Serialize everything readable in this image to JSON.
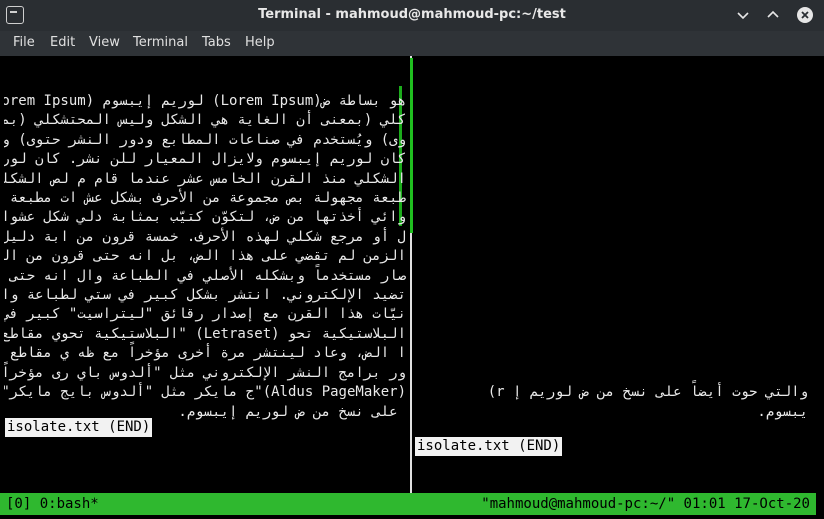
{
  "window": {
    "title": "Terminal - mahmoud@mahmoud-pc:~/test"
  },
  "menu": {
    "items": [
      {
        "label": "File"
      },
      {
        "label": "Edit"
      },
      {
        "label": "View"
      },
      {
        "label": "Terminal"
      },
      {
        "label": "Tabs"
      },
      {
        "label": "Help"
      }
    ]
  },
  "panes": {
    "left": {
      "lines": [
        "هو بساطة ض(Lorem Ipsum) لوريم إيبسوم (Lorem Ipsum)لوريم إيبسوم",
        "كلي (بمعنى أن الغاية هي الشكل وليس المحتشكلي (بمعنى أن الغاية هي الشكل وليس الم",
        "وى) ويُستخدم في صناعات المطابع ودور النشر حتوى) ويُستخدم في صناعات المطابع ودور ال",
        "كان لوريم إيبسوم ولايزال المعيار للن نشر. كان لوريم إيبسوم ولايزال المعيار ل.",
        "الشكلي منذ القرن الخامس عشر عندما قام م لص الشكلي منذ القرن الخامس عشر عندما ق",
        "طبعة مجهولة بص مجموعة من الأحرف بشكل عش ات مطبعة مجهولة بص مجموعة من الأحرف ب",
        "وائي أخذتها من ض، لتكوّن كتيّب بمثابة دلي شكل عشوائي أخذتها من ض، لتكوّن كتيّب بث",
        "ل أو مرجع شكلي لهذه الأحرف. خمسة قرون من ابة دليل أو مرجع شكلي لهذه الأحرف. خمسة",
        "الزمن لم تقضي على هذا الض، بل انه حتى قرون من الزمن لم تقضي على هذا الض، بل",
        "صار مستخدماً وبشكله الأصلي في الطباعة وال انه حتى صار مستخدماً وبشكله الأصلي في ا",
        "تضيد الإلكتروني. انتشر بشكل كبير في ستي لطباعة والتضيد الإلكتروني. انتشر بشكل",
        "نيّات هذا القرن مع إصدار رقائق \"ليتراسيت\" كبير في ستينيّات هذا القرن مع إصدار رقائ",
        "البلاستيكية تحو (Letraset) \"البلاستيكية تحوي مقاطع من هذا ق \"ليتراسيت\" (Letraset)",
        "ا الض، وعاد لينتشر مرة أخرى مؤخراً مع ظه ي مقاطع من هذا الض، وعاد لينتشر مرة أخ",
        "ور برامج النشر الإلكتروني مثل \"ألدوس باي رى مؤخراً مع ظهور برامج النشر الإلكتروني",
        "(Aldus PageMaker)\"ج مايكر مثل \"ألدوس بايج مايكر\" (Aldus PageMaker) \"والتي حوت أيض",
        "ً على نسخ من ض لوريم إيبسوم."
      ],
      "end_marker": "isolate.txt (END)"
    },
    "right": {
      "lines": [
        "",
        "",
        "",
        "",
        "",
        "",
        "",
        "",
        "",
        "",
        "",
        "",
        "",
        "",
        "",
        "والتي حوت أيضاً على نسخ من ض لوريم إ r)",
        "يبسوم."
      ],
      "end_marker": "isolate.txt (END)"
    }
  },
  "status": {
    "left": "[0] 0:bash*",
    "right": "\"mahmoud@mahmoud-pc:~/\" 01:01 17-Oct-20"
  },
  "colors": {
    "status_bg": "#2fb82f",
    "active_divider": "#1fbf1f",
    "titlebar_bg": "#2a2e32",
    "menubar_bg": "#2f3337"
  }
}
